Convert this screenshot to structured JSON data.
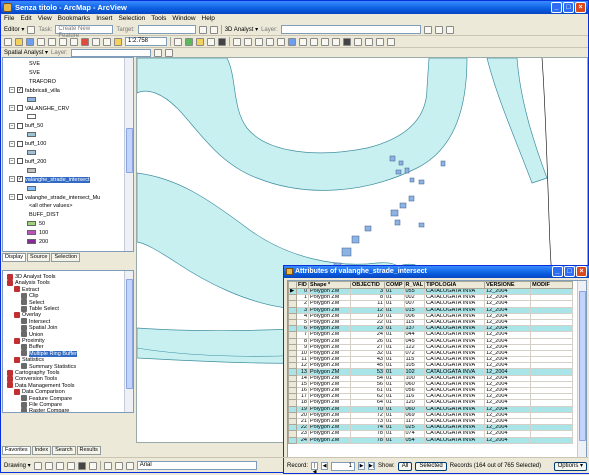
{
  "window": {
    "title": "Senza titolo - ArcMap - ArcView"
  },
  "menu": [
    "File",
    "Edit",
    "View",
    "Bookmarks",
    "Insert",
    "Selection",
    "Tools",
    "Window",
    "Help"
  ],
  "toolbar1": {
    "editor_label": "Editor ▾",
    "task_label": "Task:",
    "task_value": "Create New Feature",
    "target_label": "Target:",
    "analyst_label": "3D Analyst ▾",
    "layer_label": "Layer:"
  },
  "toolbar2": {
    "scale_value": "1:2.758"
  },
  "toolbar3": {
    "spatial_analyst_label": "Spatial Analyst ▾",
    "layer_label": "Layer:"
  },
  "toc": {
    "items": [
      {
        "kind": "legend",
        "label": "SVE"
      },
      {
        "kind": "legend",
        "label": "SVE"
      },
      {
        "kind": "legend",
        "label": "TRAFORO"
      },
      {
        "kind": "layer",
        "label": "fabbricati_villa",
        "checked": true
      },
      {
        "kind": "swatch",
        "color": "#8db3e2"
      },
      {
        "kind": "layer",
        "label": "VALANGHE_CRV",
        "checked": false
      },
      {
        "kind": "swatch",
        "color": "#ffffff"
      },
      {
        "kind": "layer",
        "label": "buff_50",
        "checked": false
      },
      {
        "kind": "swatch",
        "color": "#9fc3d6"
      },
      {
        "kind": "layer",
        "label": "buff_100",
        "checked": false
      },
      {
        "kind": "swatch",
        "color": "#9fc3d6"
      },
      {
        "kind": "layer",
        "label": "buff_200",
        "checked": false
      },
      {
        "kind": "swatch",
        "color": "#c0c0c0"
      },
      {
        "kind": "layer",
        "label": "valanghe_strade_intersect",
        "checked": true,
        "selected": true
      },
      {
        "kind": "swatch",
        "color": "#7fbfff"
      },
      {
        "kind": "layer",
        "label": "valanghe_strade_intersect_Mu",
        "checked": false
      },
      {
        "kind": "legend",
        "label": "<all other values>"
      },
      {
        "kind": "legend",
        "label": "BUFF_DIST"
      },
      {
        "kind": "swatch",
        "color": "#9bd37a",
        "label": "50"
      },
      {
        "kind": "swatch",
        "color": "#c050c0",
        "label": "100"
      },
      {
        "kind": "swatch",
        "color": "#8a2a9a",
        "label": "200"
      }
    ],
    "tabs": [
      "Display",
      "Source",
      "Selection"
    ]
  },
  "toolbox": {
    "items": [
      {
        "indent": 0,
        "label": "3D Analyst Tools",
        "color": "#c03030"
      },
      {
        "indent": 0,
        "label": "Analysis Tools",
        "color": "#c03030"
      },
      {
        "indent": 1,
        "label": "Extract",
        "color": "#c03030"
      },
      {
        "indent": 2,
        "label": "Clip",
        "color": "#6a6a6a"
      },
      {
        "indent": 2,
        "label": "Select",
        "color": "#6a6a6a"
      },
      {
        "indent": 2,
        "label": "Table Select",
        "color": "#6a6a6a"
      },
      {
        "indent": 1,
        "label": "Overlay",
        "color": "#c03030"
      },
      {
        "indent": 2,
        "label": "Intersect",
        "color": "#6a6a6a"
      },
      {
        "indent": 2,
        "label": "Spatial Join",
        "color": "#6a6a6a"
      },
      {
        "indent": 2,
        "label": "Union",
        "color": "#6a6a6a"
      },
      {
        "indent": 1,
        "label": "Proximity",
        "color": "#c03030"
      },
      {
        "indent": 2,
        "label": "Buffer",
        "color": "#6a6a6a"
      },
      {
        "indent": 2,
        "label": "Multiple Ring Buffer",
        "color": "#6a6a6a",
        "selected": true
      },
      {
        "indent": 1,
        "label": "Statistics",
        "color": "#c03030"
      },
      {
        "indent": 2,
        "label": "Summary Statistics",
        "color": "#6a6a6a"
      },
      {
        "indent": 0,
        "label": "Cartography Tools",
        "color": "#c03030"
      },
      {
        "indent": 0,
        "label": "Conversion Tools",
        "color": "#c03030"
      },
      {
        "indent": 0,
        "label": "Data Management Tools",
        "color": "#c03030"
      },
      {
        "indent": 1,
        "label": "Data Comparison",
        "color": "#c03030"
      },
      {
        "indent": 2,
        "label": "Feature Compare",
        "color": "#6a6a6a"
      },
      {
        "indent": 2,
        "label": "File Compare",
        "color": "#6a6a6a"
      },
      {
        "indent": 2,
        "label": "Raster Compare",
        "color": "#6a6a6a"
      }
    ],
    "tabs": [
      "Favorites",
      "Index",
      "Search",
      "Results"
    ]
  },
  "attr": {
    "title": "Attributes of valanghe_strade_intersect",
    "columns": [
      "FID",
      "Shape *",
      "OBJECTID",
      "COMP",
      "R_VAL",
      "TIPOLOGIA",
      "VERSIONE",
      "MODIF"
    ],
    "rows": [
      [
        "0",
        "Polygon ZM",
        "3",
        "01",
        "055",
        "CATALOGATA INVA 12_2004",
        ""
      ],
      [
        "1",
        "Polygon ZM",
        "8",
        "01",
        "002",
        "CATALOGATA INVA 12_2004",
        ""
      ],
      [
        "2",
        "Polygon ZM",
        "11",
        "01",
        "007",
        "CATALOGATA INVA 12_2004",
        ""
      ],
      [
        "3",
        "Polygon ZM",
        "12",
        "01",
        "015",
        "CATALOGATA INVA 12_2004",
        ""
      ],
      [
        "4",
        "Polygon ZM",
        "19",
        "01",
        "006",
        "CATALOGATA INVA 12_2004",
        ""
      ],
      [
        "5",
        "Polygon ZM",
        "22",
        "01",
        "115",
        "CATALOGATA INVA 12_2004",
        ""
      ],
      [
        "6",
        "Polygon ZM",
        "23",
        "01",
        "137",
        "CATALOGATA INVA 12_2004",
        ""
      ],
      [
        "7",
        "Polygon ZM",
        "24",
        "01",
        "044",
        "CATALOGATA INVA 12_2004",
        ""
      ],
      [
        "8",
        "Polygon ZM",
        "26",
        "01",
        "045",
        "CATALOGATA INVA 12_2004",
        ""
      ],
      [
        "9",
        "Polygon ZM",
        "27",
        "01",
        "122",
        "CATALOGATA INVA 12_2004",
        ""
      ],
      [
        "10",
        "Polygon ZM",
        "32",
        "01",
        "072",
        "CATALOGATA INVA 12_2004",
        ""
      ],
      [
        "11",
        "Polygon ZM",
        "43",
        "01",
        "115",
        "CATALOGATA INVA 12_2004",
        ""
      ],
      [
        "12",
        "Polygon ZM",
        "45",
        "01",
        "105",
        "CATALOGATA INVA 12_2004",
        ""
      ],
      [
        "13",
        "Polygon ZM",
        "53",
        "01",
        "102",
        "CATALOGATA INVA 12_2004",
        ""
      ],
      [
        "14",
        "Polygon ZM",
        "54",
        "01",
        "100",
        "CATALOGATA INVA 12_2004",
        ""
      ],
      [
        "15",
        "Polygon ZM",
        "56",
        "01",
        "060",
        "CATALOGATA INVA 12_2004",
        ""
      ],
      [
        "16",
        "Polygon ZM",
        "61",
        "01",
        "056",
        "CATALOGATA INVA 12_2004",
        ""
      ],
      [
        "17",
        "Polygon ZM",
        "62",
        "01",
        "116",
        "CATALOGATA INVA 12_2004",
        ""
      ],
      [
        "18",
        "Polygon ZM",
        "64",
        "01",
        "120",
        "CATALOGATA INVA 12_2004",
        ""
      ],
      [
        "19",
        "Polygon ZM",
        "70",
        "01",
        "060",
        "CATALOGATA INVA 12_2004",
        ""
      ],
      [
        "20",
        "Polygon ZM",
        "72",
        "01",
        "069",
        "CATALOGATA INVA 12_2004",
        ""
      ],
      [
        "21",
        "Polygon ZM",
        "73",
        "01",
        "117",
        "CATALOGATA INVA 12_2004",
        ""
      ],
      [
        "22",
        "Polygon ZM",
        "74",
        "01",
        "025",
        "CATALOGATA INVA 12_2004",
        ""
      ],
      [
        "23",
        "Polygon ZM",
        "78",
        "01",
        "074",
        "CATALOGATA INVA 12_2004",
        ""
      ],
      [
        "24",
        "Polygon ZM",
        "78",
        "01",
        "054",
        "CATALOGATA INVA 12_2004",
        ""
      ]
    ],
    "selected_rows": [
      0,
      3,
      6,
      13,
      19,
      22,
      24
    ],
    "record_label": "Record:",
    "record_value": "1",
    "show_label": "Show:",
    "all_label": "All",
    "selected_label": "Selected",
    "records_summary": "Records (164 out of 765 Selected)",
    "options_label": "Options ▾"
  },
  "statusbar": {
    "drawing_label": "Drawing ▾",
    "font_value": "Arial"
  },
  "colors": {
    "water": "#c8f0f0",
    "water_edge": "#3e8ea0",
    "buildings": "#8db3e2"
  }
}
